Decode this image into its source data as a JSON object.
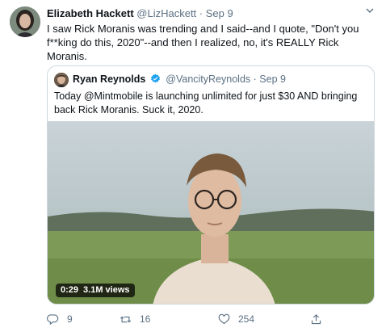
{
  "tweet": {
    "author_name": "Elizabeth Hackett",
    "author_handle": "@LizHackett",
    "separator": "·",
    "date": "Sep 9",
    "text": "I saw Rick Moranis was trending and I said--and I quote, \"Don't you f**king do this, 2020\"--and then I realized, no, it's REALLY Rick Moranis."
  },
  "quoted_tweet": {
    "author_name": "Ryan Reynolds",
    "verified": true,
    "author_handle": "@VancityReynolds",
    "separator": "·",
    "date": "Sep 9",
    "text": "Today @Mintmobile is launching unlimited for just $30 AND bringing back Rick Moranis. Suck it, 2020.",
    "video": {
      "duration": "0:29",
      "views": "3.1M views"
    }
  },
  "actions": {
    "reply_count": "9",
    "retweet_count": "16",
    "like_count": "254"
  },
  "colors": {
    "text_primary": "#0f1419",
    "text_secondary": "#5b7083",
    "border": "#cfd9de",
    "verified_blue": "#1da1f2"
  },
  "icons": [
    "more-icon",
    "verified-icon",
    "reply-icon",
    "retweet-icon",
    "like-icon",
    "share-icon"
  ]
}
